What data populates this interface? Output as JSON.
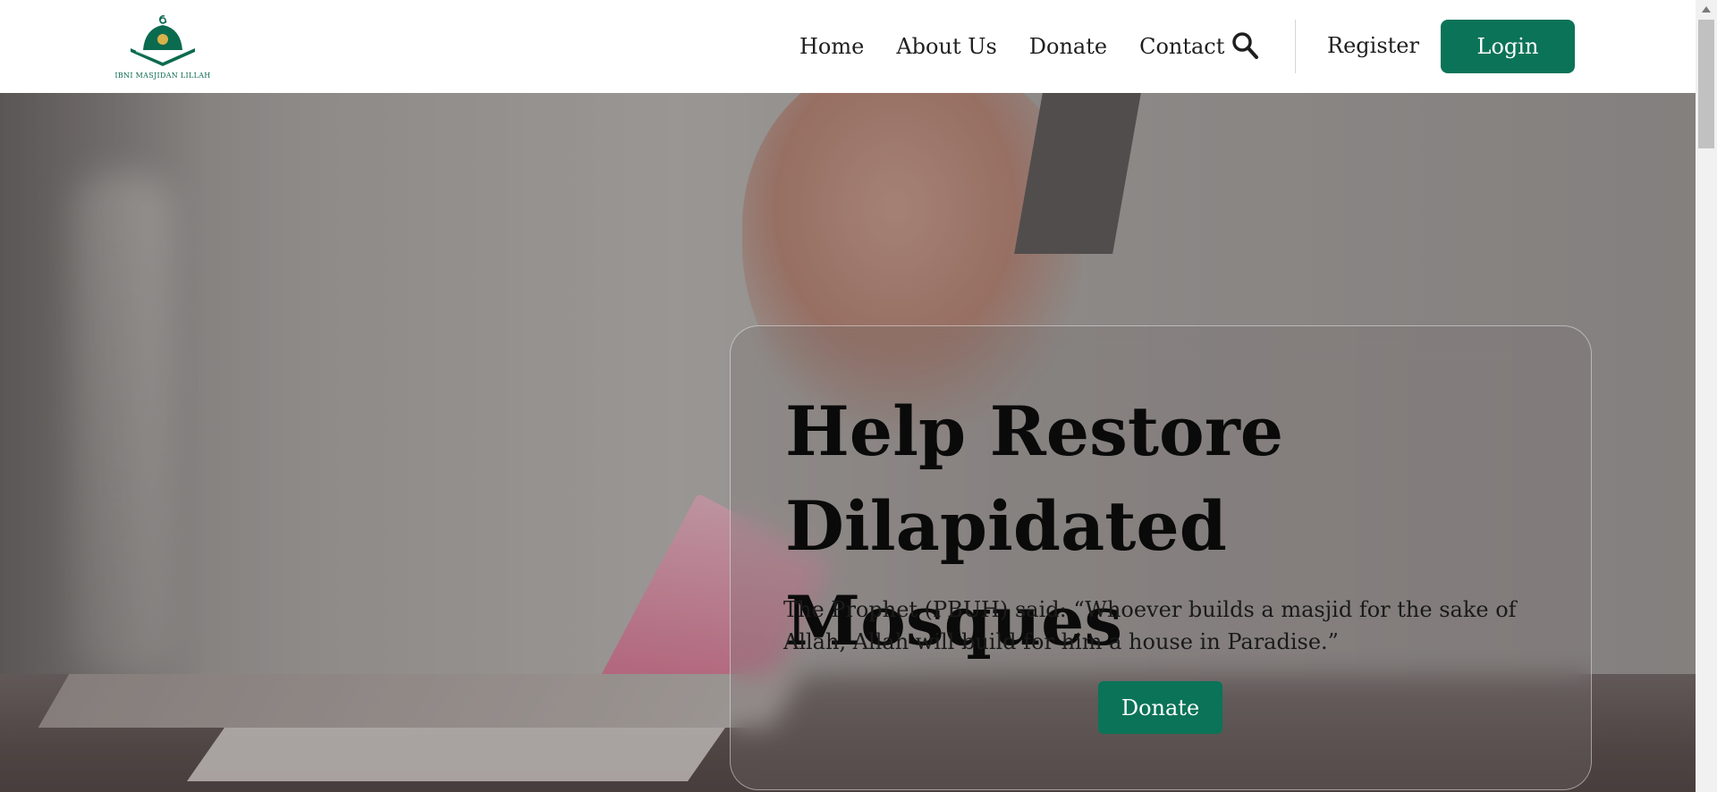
{
  "brand": {
    "logo_text": "IBNI MASJIDAN LILLAH",
    "primary_color": "#0b7358"
  },
  "nav": {
    "links": [
      "Home",
      "About Us",
      "Donate",
      "Contact"
    ],
    "search_icon": "search-icon",
    "register_label": "Register",
    "login_label": "Login"
  },
  "hero": {
    "title_line1": "Help Restore",
    "title_line2": "Dilapidated Mosques",
    "quote": "The Prophet (PBUH) said: “Whoever builds a masjid for the sake of Allah, Allah will build for him a house in Paradise.”",
    "donate_label": "Donate"
  }
}
